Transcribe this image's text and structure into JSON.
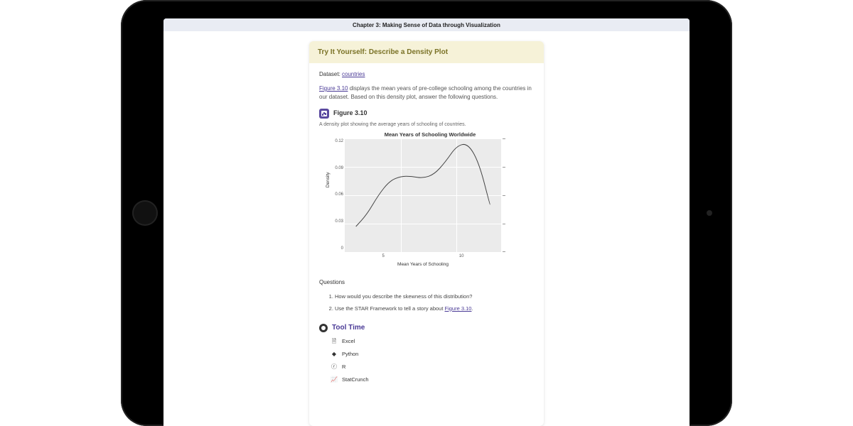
{
  "topbar": {
    "title": "Chapter 3: Making Sense of Data through Visualization"
  },
  "card": {
    "header": "Try It Yourself: Describe a Density Plot",
    "dataset_label": "Dataset:",
    "dataset_link": "countries",
    "figure_link": "Figure 3.10",
    "desc_after_link": " displays the mean years of pre-college schooling among the countries in our dataset. Based on this density plot, answer the following questions.",
    "figure_heading": "Figure 3.10",
    "figure_caption": "A density plot showing the average years of schooling of countries.",
    "questions_heading": "Questions",
    "q1": "How would you describe the skewness of this distribution?",
    "q2_before": "Use the STAR Framework to tell a story about ",
    "q2_link": "Figure 3.10",
    "q2_after": ".",
    "tooltime_heading": "Tool Time",
    "tools": {
      "excel": "Excel",
      "python": "Python",
      "r": "R",
      "statcrunch": "StatCrunch"
    }
  },
  "chart_data": {
    "type": "line",
    "title": "Mean Years of Schooling Worldwide",
    "xlabel": "Mean Years of Schooling",
    "ylabel": "Density",
    "xlim": [
      0,
      14
    ],
    "ylim": [
      0,
      0.12
    ],
    "x_ticks": [
      5,
      10
    ],
    "y_ticks": [
      0.0,
      0.03,
      0.06,
      0.09,
      0.12
    ],
    "series": [
      {
        "name": "density",
        "x": [
          1,
          2,
          3,
          4,
          5,
          6,
          7,
          8,
          9,
          10,
          11,
          12,
          13
        ],
        "values": [
          0.027,
          0.04,
          0.06,
          0.075,
          0.08,
          0.08,
          0.078,
          0.082,
          0.095,
          0.112,
          0.115,
          0.095,
          0.05
        ]
      }
    ]
  }
}
